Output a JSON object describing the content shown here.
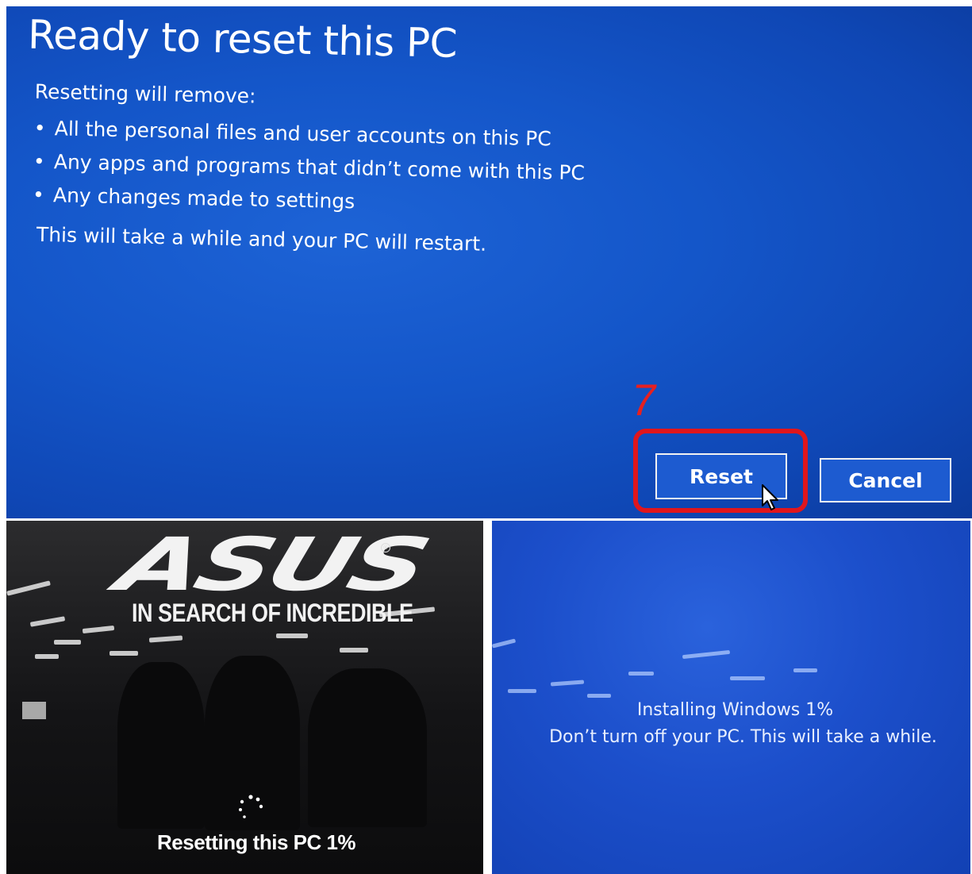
{
  "reset_dialog": {
    "title": "Ready to reset this PC",
    "subtitle": "Resetting will remove:",
    "items": [
      "All the personal files and user accounts on this PC",
      "Any apps and programs that didn’t come with this PC",
      "Any changes made to settings"
    ],
    "note": "This will take a while and your PC will restart.",
    "step_number": "7",
    "reset_label": "Reset",
    "cancel_label": "Cancel"
  },
  "asus_boot": {
    "logo": "ASUS",
    "tagline": "IN SEARCH OF INCREDIBLE",
    "status": "Resetting this PC 1%"
  },
  "install_screen": {
    "line1": "Installing Windows  1%",
    "line2": "Don’t turn off your PC. This will take a while."
  },
  "colors": {
    "dialog_blue": "#1456c9",
    "highlight_red": "#e0161c",
    "install_blue": "#1c4fcb"
  }
}
